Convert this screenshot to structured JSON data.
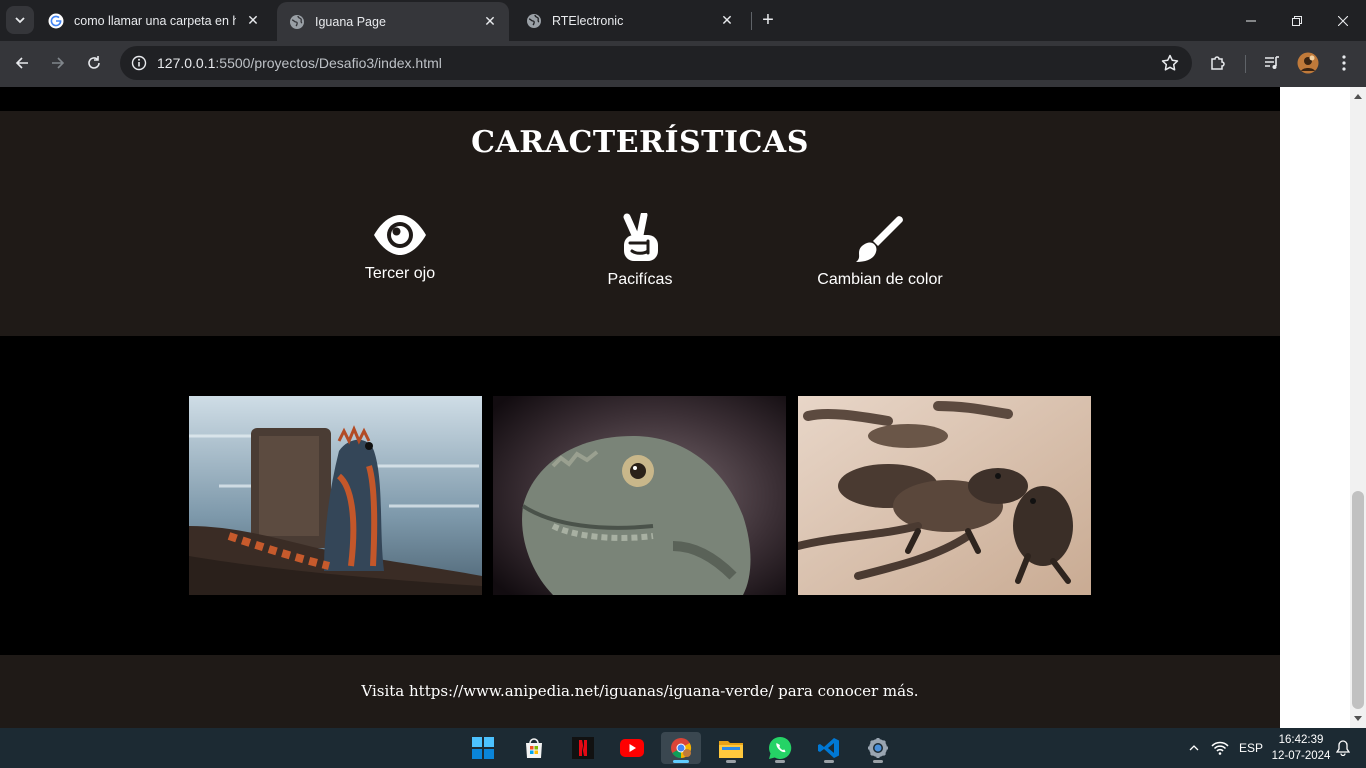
{
  "browser": {
    "tabs": [
      {
        "title": "como llamar una carpeta en htm",
        "favicon": "google-icon",
        "active": false
      },
      {
        "title": "Iguana Page",
        "favicon": "globe-icon",
        "active": true
      },
      {
        "title": "RTElectronic",
        "favicon": "globe-icon",
        "active": false
      }
    ],
    "url_host": "127.0.0.1",
    "url_path": ":5500/proyectos/Desafio3/index.html"
  },
  "page": {
    "features": {
      "title": "CARACTERÍSTICAS",
      "items": [
        {
          "icon": "eye-icon",
          "label": "Tercer ojo"
        },
        {
          "icon": "peace-hand-icon",
          "label": "Pacifícas"
        },
        {
          "icon": "paintbrush-icon",
          "label": "Cambian de color"
        }
      ]
    },
    "gallery": [
      {
        "name": "iguana-on-rocks-photo"
      },
      {
        "name": "iguana-closeup-photo"
      },
      {
        "name": "iguanas-on-beach-photo"
      }
    ],
    "footer": {
      "text": "Visita https://www.anipedia.net/iguanas/iguana-verde/ para conocer más."
    }
  },
  "taskbar": {
    "apps": [
      "windows-start-icon",
      "microsoft-store-icon",
      "netflix-icon",
      "youtube-icon",
      "chrome-icon",
      "file-explorer-icon",
      "whatsapp-icon",
      "vscode-icon",
      "settings-icon"
    ],
    "language": "ESP",
    "time": "16:42:39",
    "date": "12-07-2024"
  },
  "colors": {
    "section_bg": "#1f1a17",
    "page_bg": "#000000",
    "tab_active_bg": "#35363a",
    "taskbar_bg": "#1c2a33"
  }
}
